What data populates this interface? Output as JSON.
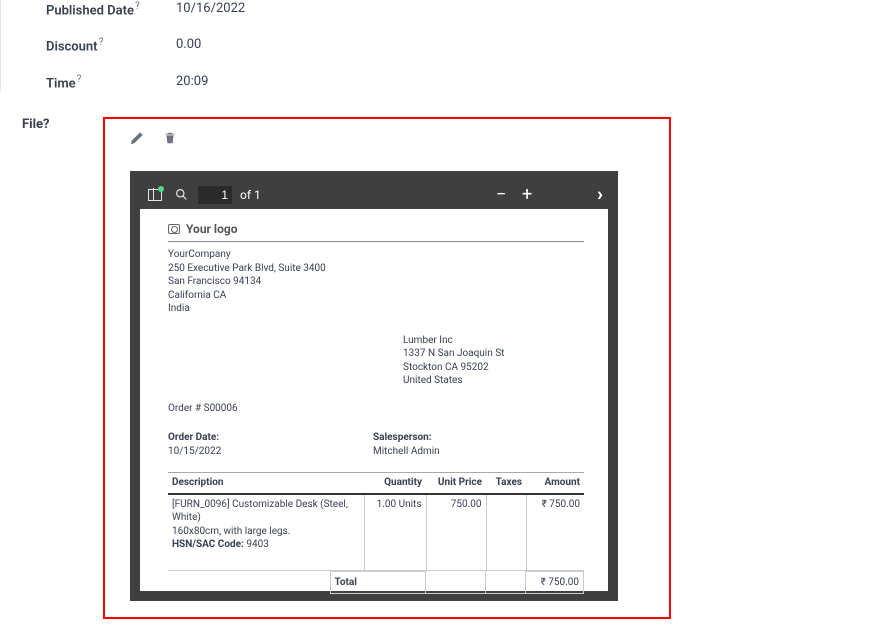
{
  "fields": {
    "published_date": {
      "label": "Published Date",
      "value": "10/16/2022"
    },
    "discount": {
      "label": "Discount",
      "value": "0.00"
    },
    "time": {
      "label": "Time",
      "value": "20:09"
    },
    "file": {
      "label": "File"
    }
  },
  "help_marker": "?",
  "pdf_toolbar": {
    "page_input": "1",
    "page_of": "of 1"
  },
  "invoice": {
    "logo_text": "Your logo",
    "company": {
      "name": "YourCompany",
      "address1": "250 Executive Park Blvd, Suite 3400",
      "address2": "San Francisco 94134",
      "state": "California CA",
      "country": "India"
    },
    "customer": {
      "name": "Lumber Inc",
      "address1": "1337 N San Joaquin St",
      "city": "Stockton CA 95202",
      "country": "United States"
    },
    "order_number": "Order # S00006",
    "order_date_label": "Order Date:",
    "order_date": "10/15/2022",
    "salesperson_label": "Salesperson:",
    "salesperson": "Mitchell Admin",
    "columns": {
      "description": "Description",
      "quantity": "Quantity",
      "unit_price": "Unit Price",
      "taxes": "Taxes",
      "amount": "Amount"
    },
    "items": [
      {
        "desc_line1": "[FURN_0096] Customizable Desk (Steel, White)",
        "desc_line2": "160x80cm, with large legs.",
        "hsn_label": "HSN/SAC Code:",
        "hsn_value": "9403",
        "quantity": "1.00 Units",
        "unit_price": "750.00",
        "taxes": "",
        "amount": "₹ 750.00"
      }
    ],
    "total_label": "Total",
    "total_value": "₹ 750.00"
  }
}
